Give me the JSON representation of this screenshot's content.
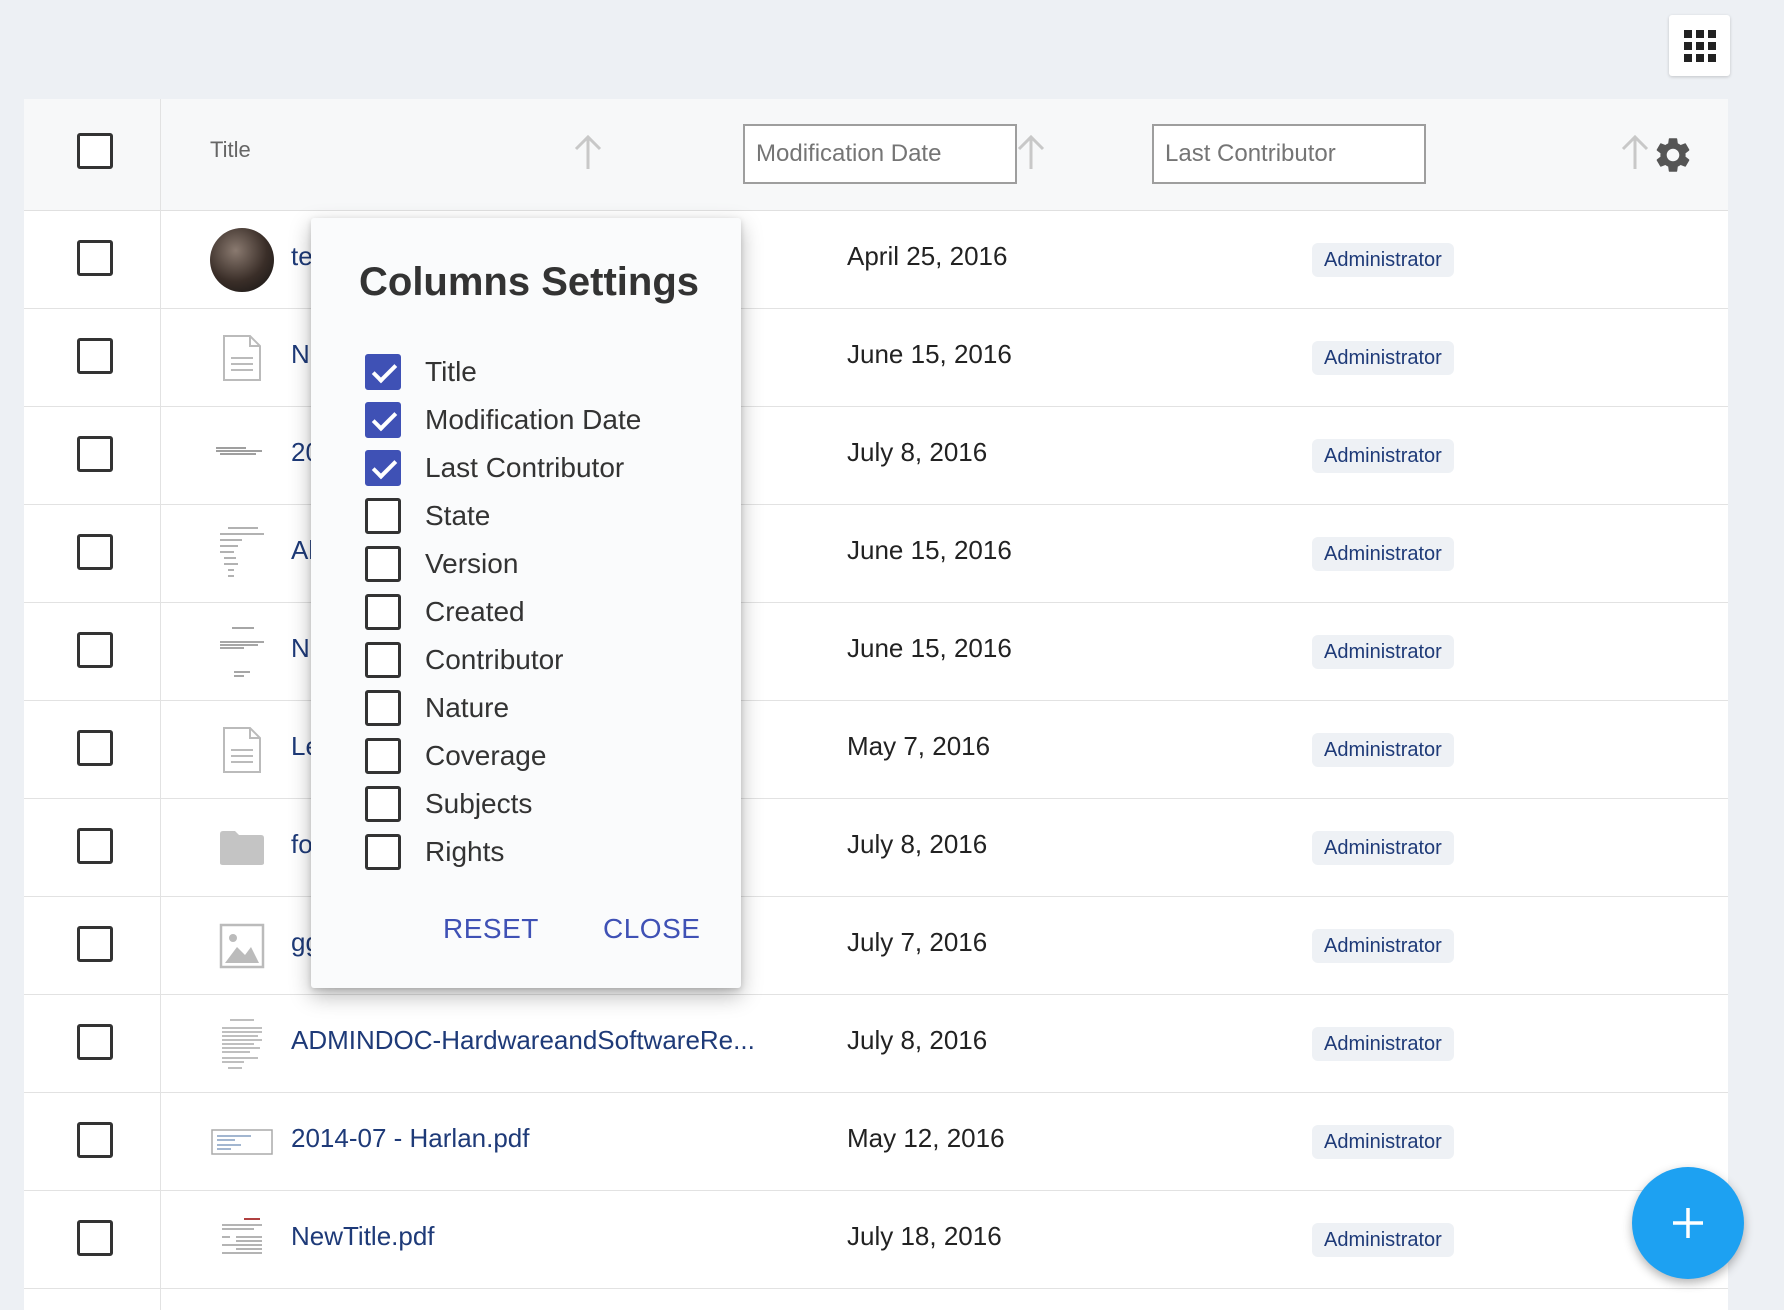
{
  "header": {
    "title_label": "Title",
    "modification_date_placeholder": "Modification Date",
    "last_contributor_placeholder": "Last Contributor"
  },
  "rows": [
    {
      "name": "te",
      "date": "April 25, 2016",
      "contributor": "Administrator",
      "thumb": "avatar-photo"
    },
    {
      "name": "N",
      "date": "June 15, 2016",
      "contributor": "Administrator",
      "thumb": "note-icon"
    },
    {
      "name": "20",
      "date": "July 8, 2016",
      "contributor": "Administrator",
      "thumb": "doc-thumb"
    },
    {
      "name": "Al",
      "date": "June 15, 2016",
      "contributor": "Administrator",
      "thumb": "doc-thumb"
    },
    {
      "name": "N",
      "date": "June 15, 2016",
      "contributor": "Administrator",
      "thumb": "doc-thumb"
    },
    {
      "name": "Le",
      "date": "May 7, 2016",
      "contributor": "Administrator",
      "thumb": "note-icon"
    },
    {
      "name": "fo",
      "date": "July 8, 2016",
      "contributor": "Administrator",
      "thumb": "folder-icon"
    },
    {
      "name": "gg",
      "date": "July 7, 2016",
      "contributor": "Administrator",
      "thumb": "image-icon"
    },
    {
      "name": "ADMINDOC-HardwareandSoftwareRe...",
      "date": "July 8, 2016",
      "contributor": "Administrator",
      "thumb": "doc-thumb"
    },
    {
      "name": "2014-07 - Harlan.pdf",
      "date": "May 12, 2016",
      "contributor": "Administrator",
      "thumb": "pdf-thumb"
    },
    {
      "name": "NewTitle.pdf",
      "date": "July 18, 2016",
      "contributor": "Administrator",
      "thumb": "doc-thumb"
    }
  ],
  "popup": {
    "title": "Columns Settings",
    "options": [
      {
        "label": "Title",
        "checked": true
      },
      {
        "label": "Modification Date",
        "checked": true
      },
      {
        "label": "Last Contributor",
        "checked": true
      },
      {
        "label": "State",
        "checked": false
      },
      {
        "label": "Version",
        "checked": false
      },
      {
        "label": "Created",
        "checked": false
      },
      {
        "label": "Contributor",
        "checked": false
      },
      {
        "label": "Nature",
        "checked": false
      },
      {
        "label": "Coverage",
        "checked": false
      },
      {
        "label": "Subjects",
        "checked": false
      },
      {
        "label": "Rights",
        "checked": false
      }
    ],
    "reset_label": "RESET",
    "close_label": "CLOSE"
  },
  "colors": {
    "accent": "#3f51b5",
    "link": "#1e3a78",
    "fab": "#1da1f2"
  }
}
